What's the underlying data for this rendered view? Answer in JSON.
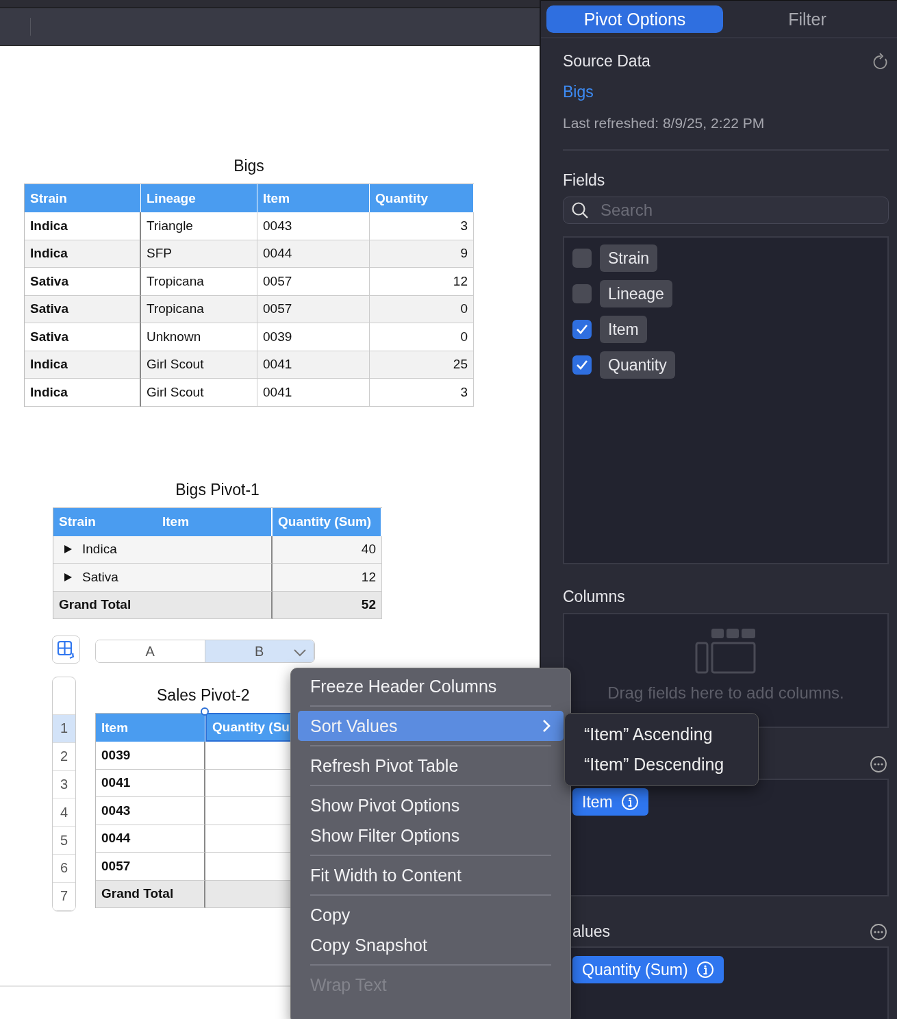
{
  "bigs_table": {
    "title": "Bigs",
    "columns": [
      "Strain",
      "Lineage",
      "Item",
      "Quantity"
    ],
    "rows": [
      [
        "Indica",
        "Triangle",
        "0043",
        "3"
      ],
      [
        "Indica",
        "SFP",
        "0044",
        "9"
      ],
      [
        "Sativa",
        "Tropicana",
        "0057",
        "12"
      ],
      [
        "Sativa",
        "Tropicana",
        "0057",
        "0"
      ],
      [
        "Sativa",
        "Unknown",
        "0039",
        "0"
      ],
      [
        "Indica",
        "Girl Scout",
        "0041",
        "25"
      ],
      [
        "Indica",
        "Girl Scout",
        "0041",
        "3"
      ]
    ]
  },
  "pivot_table": {
    "title": "Bigs Pivot-1",
    "header": {
      "row_fields": [
        "Strain",
        "Item"
      ],
      "value_field": "Quantity (Sum)"
    },
    "rows": [
      {
        "kind": "group",
        "label": "Indica",
        "value": "40",
        "expanded": false
      },
      {
        "kind": "group",
        "label": "Sativa",
        "value": "12",
        "expanded": false
      },
      {
        "kind": "total",
        "label": "Grand Total",
        "value": "52"
      }
    ]
  },
  "sales_pivot": {
    "title": "Sales Pivot-2",
    "column_headers": [
      {
        "label": "A",
        "selected": false
      },
      {
        "label": "B",
        "selected": true
      }
    ],
    "row_headers": [
      {
        "label": "1",
        "selected": true
      },
      {
        "label": "2",
        "selected": false
      },
      {
        "label": "3",
        "selected": false
      },
      {
        "label": "4",
        "selected": false
      },
      {
        "label": "5",
        "selected": false
      },
      {
        "label": "6",
        "selected": false
      },
      {
        "label": "7",
        "selected": false
      }
    ],
    "header": [
      "Item",
      "Quantity (Su"
    ],
    "rows": [
      {
        "kind": "item",
        "label": "0039"
      },
      {
        "kind": "item",
        "label": "0041"
      },
      {
        "kind": "item",
        "label": "0043"
      },
      {
        "kind": "item",
        "label": "0044"
      },
      {
        "kind": "item",
        "label": "0057"
      },
      {
        "kind": "total",
        "label": "Grand Total"
      }
    ]
  },
  "context_menu": {
    "groups": [
      [
        {
          "label": "Freeze Header Columns",
          "selected": false,
          "submenu": false,
          "disabled": false
        }
      ],
      [
        {
          "label": "Sort Values",
          "selected": true,
          "submenu": true,
          "disabled": false
        }
      ],
      [
        {
          "label": "Refresh Pivot Table",
          "selected": false,
          "submenu": false,
          "disabled": false
        }
      ],
      [
        {
          "label": "Show Pivot Options",
          "selected": false,
          "submenu": false,
          "disabled": false
        },
        {
          "label": "Show Filter Options",
          "selected": false,
          "submenu": false,
          "disabled": false
        }
      ],
      [
        {
          "label": "Fit Width to Content",
          "selected": false,
          "submenu": false,
          "disabled": false
        }
      ],
      [
        {
          "label": "Copy",
          "selected": false,
          "submenu": false,
          "disabled": false
        },
        {
          "label": "Copy Snapshot",
          "selected": false,
          "submenu": false,
          "disabled": false
        }
      ],
      [
        {
          "label": "Wrap Text",
          "selected": false,
          "submenu": false,
          "disabled": true
        }
      ]
    ],
    "submenu": [
      "“Item” Ascending",
      "“Item” Descending"
    ]
  },
  "sidebar": {
    "tabs": [
      {
        "label": "Pivot Options",
        "selected": true
      },
      {
        "label": "Filter",
        "selected": false
      }
    ],
    "source_data": {
      "heading": "Source Data",
      "table_link": "Bigs",
      "last_refreshed": "Last refreshed: 8/9/25, 2:22 PM"
    },
    "fields": {
      "heading": "Fields",
      "search": {
        "placeholder": "Search"
      },
      "items": [
        {
          "label": "Strain",
          "checked": false
        },
        {
          "label": "Lineage",
          "checked": false
        },
        {
          "label": "Item",
          "checked": true
        },
        {
          "label": "Quantity",
          "checked": true
        }
      ]
    },
    "columns": {
      "heading": "Columns",
      "placeholder": "Drag fields here to add columns."
    },
    "rows": {
      "chips": [
        "Item"
      ]
    },
    "values": {
      "heading": "alues",
      "chips": [
        "Quantity (Sum)"
      ]
    }
  }
}
